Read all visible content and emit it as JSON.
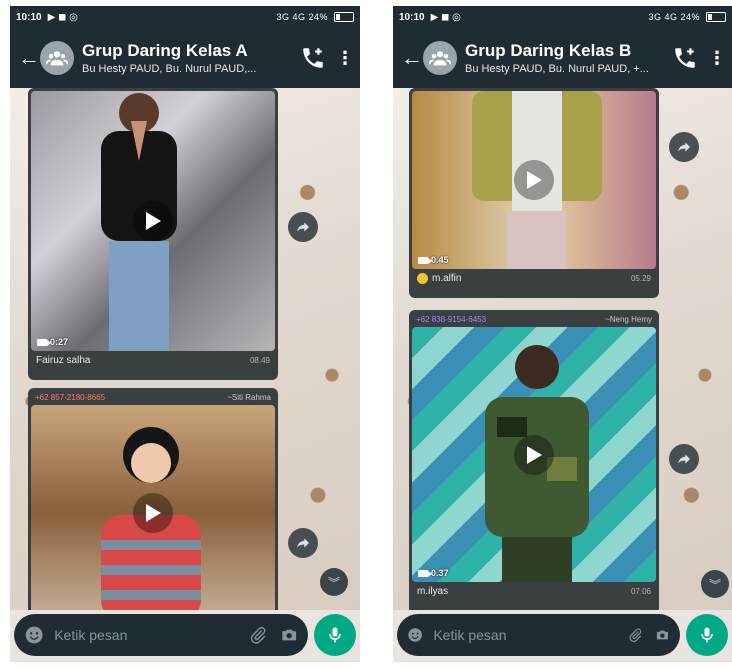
{
  "screens": [
    {
      "status_time": "10:10",
      "status_icons": "3G 4G",
      "battery": "24%",
      "title": "Grup Daring Kelas A",
      "subtitle": "Bu Hesty PAUD, Bu. Nurul PAUD,...",
      "messages": [
        {
          "sender": "",
          "alias": "",
          "duration": "0:27",
          "caption": "Fairuz salha",
          "time": "08.49"
        },
        {
          "sender": "+62 857-2180-8665",
          "alias": "~Siti Rahma",
          "duration": "",
          "caption": "",
          "time": ""
        }
      ],
      "input_placeholder": "Ketik pesan"
    },
    {
      "status_time": "10:10",
      "status_icons": "3G 4G",
      "battery": "24%",
      "title": "Grup Daring Kelas B",
      "subtitle": "Bu Hesty PAUD, Bu. Nurul PAUD, +...",
      "messages": [
        {
          "sender": "",
          "alias": "",
          "duration": "0.45",
          "caption": "m.alfin",
          "time": "05.29"
        },
        {
          "sender": "+62 838-9154-6453",
          "alias": "~Neng Hemy",
          "duration": "0.37",
          "caption": "m.ilyas",
          "time": "07.06"
        }
      ],
      "input_placeholder": "Ketik pesan"
    }
  ],
  "colors": {
    "header": "#1f2c33",
    "bubble": "#3a3f42",
    "accent": "#00a884",
    "sender": "#ff7b5a"
  },
  "icons": [
    "back-arrow-icon",
    "group-avatar-icon",
    "add-call-icon",
    "more-vert-icon",
    "play-icon",
    "video-camera-icon",
    "forward-icon",
    "emoji-icon",
    "attach-icon",
    "camera-icon",
    "mic-icon",
    "chevron-down-double-icon"
  ]
}
